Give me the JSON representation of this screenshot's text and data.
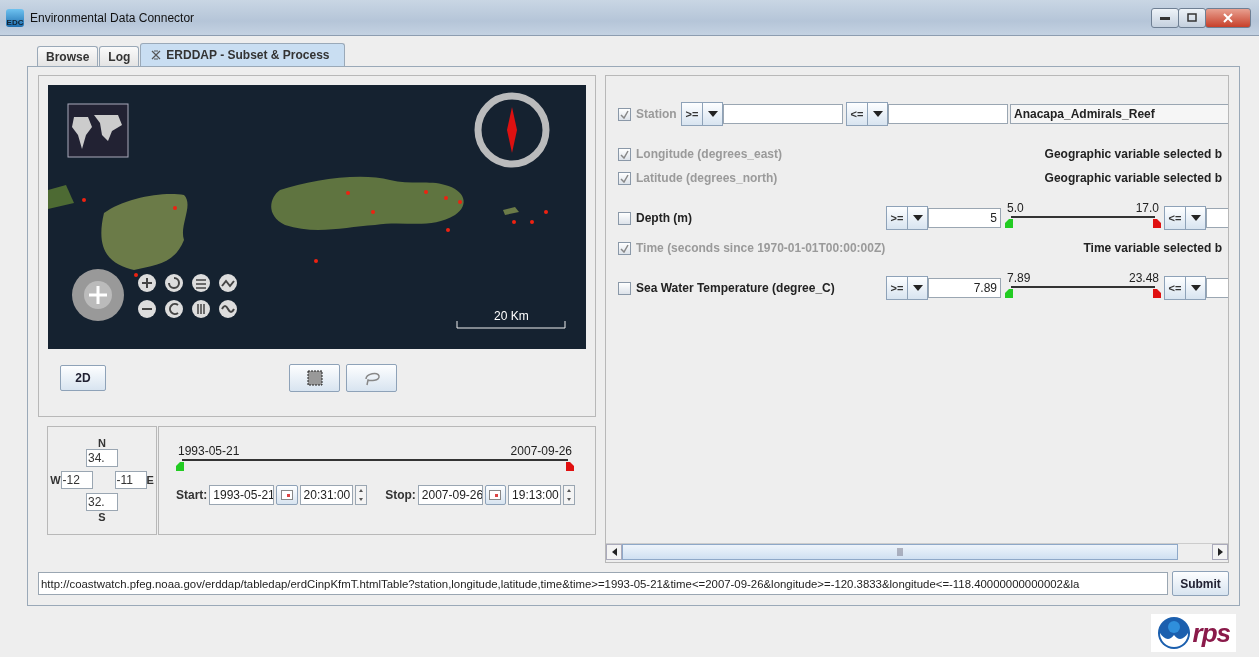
{
  "window": {
    "icon_label": "EDC",
    "title": "Environmental Data Connector"
  },
  "tabs": [
    {
      "label": "Browse",
      "selected": false,
      "closable": false
    },
    {
      "label": "Log",
      "selected": false,
      "closable": false
    },
    {
      "label": "ERDDAP - Subset & Process",
      "selected": true,
      "closable": true
    }
  ],
  "map": {
    "scale_label": "20 Km"
  },
  "view_button": "2D",
  "bounds": {
    "north_label": "N",
    "north": "34.",
    "west_label": "W",
    "west": "-12",
    "east": "-11",
    "east_label": "E",
    "south": "32.",
    "south_label": "S"
  },
  "time_range": {
    "min_label": "1993-05-21",
    "max_label": "2007-09-26",
    "thumbs": [
      {
        "level": 0
      },
      {
        "level": 1
      }
    ],
    "start": {
      "label": "Start:",
      "date": "1993-05-21",
      "time": "20:31:00"
    },
    "stop": {
      "label": "Stop:",
      "date": "2007-09-26",
      "time": "19:13:00"
    }
  },
  "variables": [
    {
      "kind": "text",
      "label": "Station",
      "checked": true,
      "disabled": true,
      "op_low": ">=",
      "op_high": "<=",
      "selection": "Anacapa_Admirals_Reef"
    },
    {
      "kind": "note",
      "label": "Longitude (degrees_east)",
      "checked": true,
      "disabled": true,
      "note": "Geographic variable selected b"
    },
    {
      "kind": "note",
      "label": "Latitude (degrees_north)",
      "checked": true,
      "disabled": true,
      "note": "Geographic variable selected b"
    },
    {
      "kind": "range",
      "label": "Depth (m)",
      "checked": false,
      "disabled": false,
      "op_low": ">=",
      "value_low": "5",
      "min_label": "5.0",
      "max_label": "17.0",
      "thumbs": [
        {
          "level": 0
        },
        {
          "level": 1
        }
      ],
      "op_high": "<="
    },
    {
      "kind": "note",
      "label": "Time (seconds since 1970-01-01T00:00:00Z)",
      "checked": true,
      "disabled": true,
      "note": "Time variable selected b"
    },
    {
      "kind": "range",
      "label": "Sea Water Temperature (degree_C)",
      "checked": false,
      "disabled": false,
      "op_low": ">=",
      "value_low": "7.89",
      "min_label": "7.89",
      "max_label": "23.48",
      "thumbs": [
        {
          "level": 0
        },
        {
          "level": 1
        }
      ],
      "op_high": "<="
    }
  ],
  "url": "http://coastwatch.pfeg.noaa.gov/erddap/tabledap/erdCinpKfmT.htmlTable?station,longitude,latitude,time&time>=1993-05-21&time<=2007-09-26&longitude>=-120.3833&longitude<=-118.40000000000002&la",
  "submit": "Submit",
  "logo_text": "rps"
}
